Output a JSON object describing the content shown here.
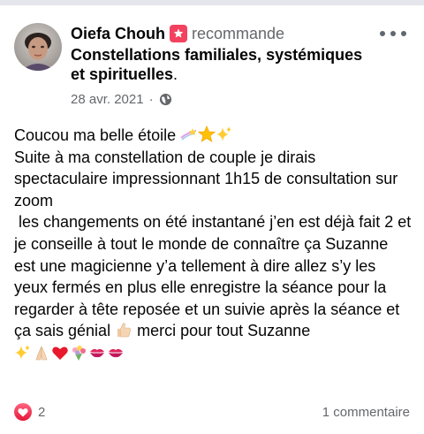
{
  "post": {
    "author": "Oiefa Chouh",
    "action": "recommande",
    "page": "Constellations familiales, systémiques et spirituelles",
    "page_suffix": ".",
    "date": "28 avr. 2021",
    "separator": "·",
    "privacy_icon": "globe-icon",
    "recommend_icon": "recommend-badge-icon",
    "body_lines": [
      "Coucou ma belle étoile",
      "Suite à ma constellation de couple je dirais spectaculaire impressionnant 1h15 de consultation sur zoom",
      " les changements on été instantané j’en est déjà fait 2 et je conseille à tout le monde de connaître ça Suzanne est une magicienne y’a tellement à dire allez s’y les yeux fermés en plus elle enregistre la séance pour la regarder à tête reposée et un suivie après la séance et ça sais génial",
      " merci pour tout Suzanne"
    ],
    "emoji_after_greeting": [
      "shooting-star",
      "star",
      "sparkles"
    ],
    "emoji_after_genial": "thumbs-up",
    "emoji_final_row": [
      "sparkles",
      "folded-hands",
      "red-heart",
      "bouquet",
      "kiss-mark",
      "kiss-mark"
    ]
  },
  "footer": {
    "reaction_icon": "heart-reaction-icon",
    "reaction_count": "2",
    "comments": "1 commentaire"
  },
  "colors": {
    "text": "#050505",
    "secondary": "#65676b",
    "heart": "#f33e58",
    "badge": "#f3425f"
  }
}
